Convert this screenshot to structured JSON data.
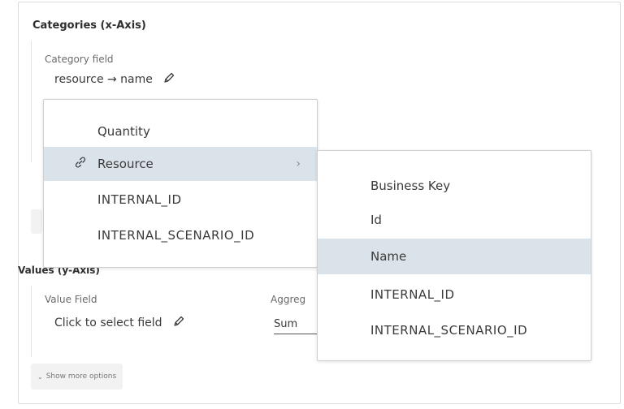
{
  "categories": {
    "title": "Categories (x-Axis)",
    "field_label": "Category field",
    "field_value": "resource → name"
  },
  "values": {
    "title": "Values (y-Axis)",
    "field_label": "Value Field",
    "field_value": "Click to select field",
    "aggregation_label": "Aggreg",
    "aggregation_value": "Sum"
  },
  "show_more": "Show more options",
  "menu_primary": {
    "items": [
      {
        "label": "Quantity",
        "icon": null,
        "has_submenu": false,
        "selected": false
      },
      {
        "label": "Resource",
        "icon": "link-icon",
        "has_submenu": true,
        "selected": true
      },
      {
        "label": "INTERNAL_ID",
        "icon": null,
        "has_submenu": false,
        "selected": false
      },
      {
        "label": "INTERNAL_SCENARIO_ID",
        "icon": null,
        "has_submenu": false,
        "selected": false
      }
    ]
  },
  "menu_submenu": {
    "items": [
      {
        "label": "Business Key",
        "selected": false
      },
      {
        "label": "Id",
        "selected": false
      },
      {
        "label": "Name",
        "selected": true
      },
      {
        "label": "INTERNAL_ID",
        "selected": false
      },
      {
        "label": "INTERNAL_SCENARIO_ID",
        "selected": false
      }
    ]
  },
  "colors": {
    "selected_bg": "#dbe3ea",
    "border": "#cfcfcf"
  }
}
